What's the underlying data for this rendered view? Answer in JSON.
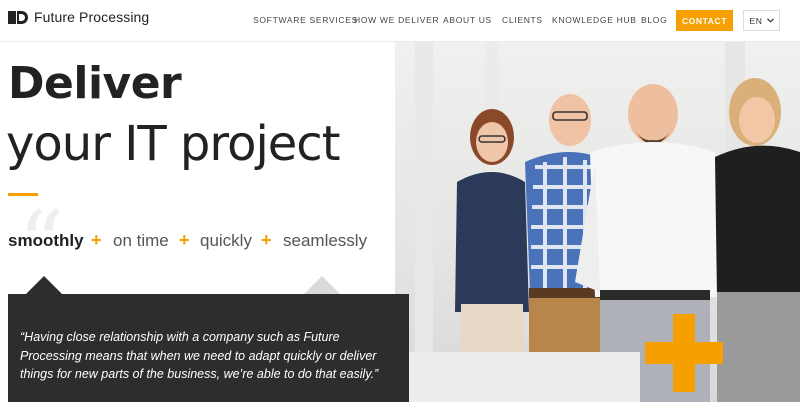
{
  "brand": {
    "name": "Future Processing"
  },
  "nav": {
    "items": [
      "SOFTWARE SERVICES",
      "HOW WE DELIVER",
      "ABOUT US",
      "CLIENTS",
      "KNOWLEDGE HUB",
      "BLOG"
    ],
    "contact_label": "CONTACT",
    "lang_label": "EN"
  },
  "hero": {
    "title_line1": "Deliver",
    "title_line2": "your IT project",
    "tags": [
      "smoothly",
      "on time",
      "quickly",
      "seamlessly"
    ],
    "plus_symbol": "+",
    "quote": "“Having close relationship with a company such as Future Processing means that when we need to adapt quickly or deliver things for new parts of the business, we’re able to do that easily.”"
  },
  "colors": {
    "accent": "#f5a000",
    "dark": "#2d2d2d"
  },
  "icons": {
    "lang_dropdown": "chevron-down-icon",
    "logo": "logo-mark-icon"
  }
}
